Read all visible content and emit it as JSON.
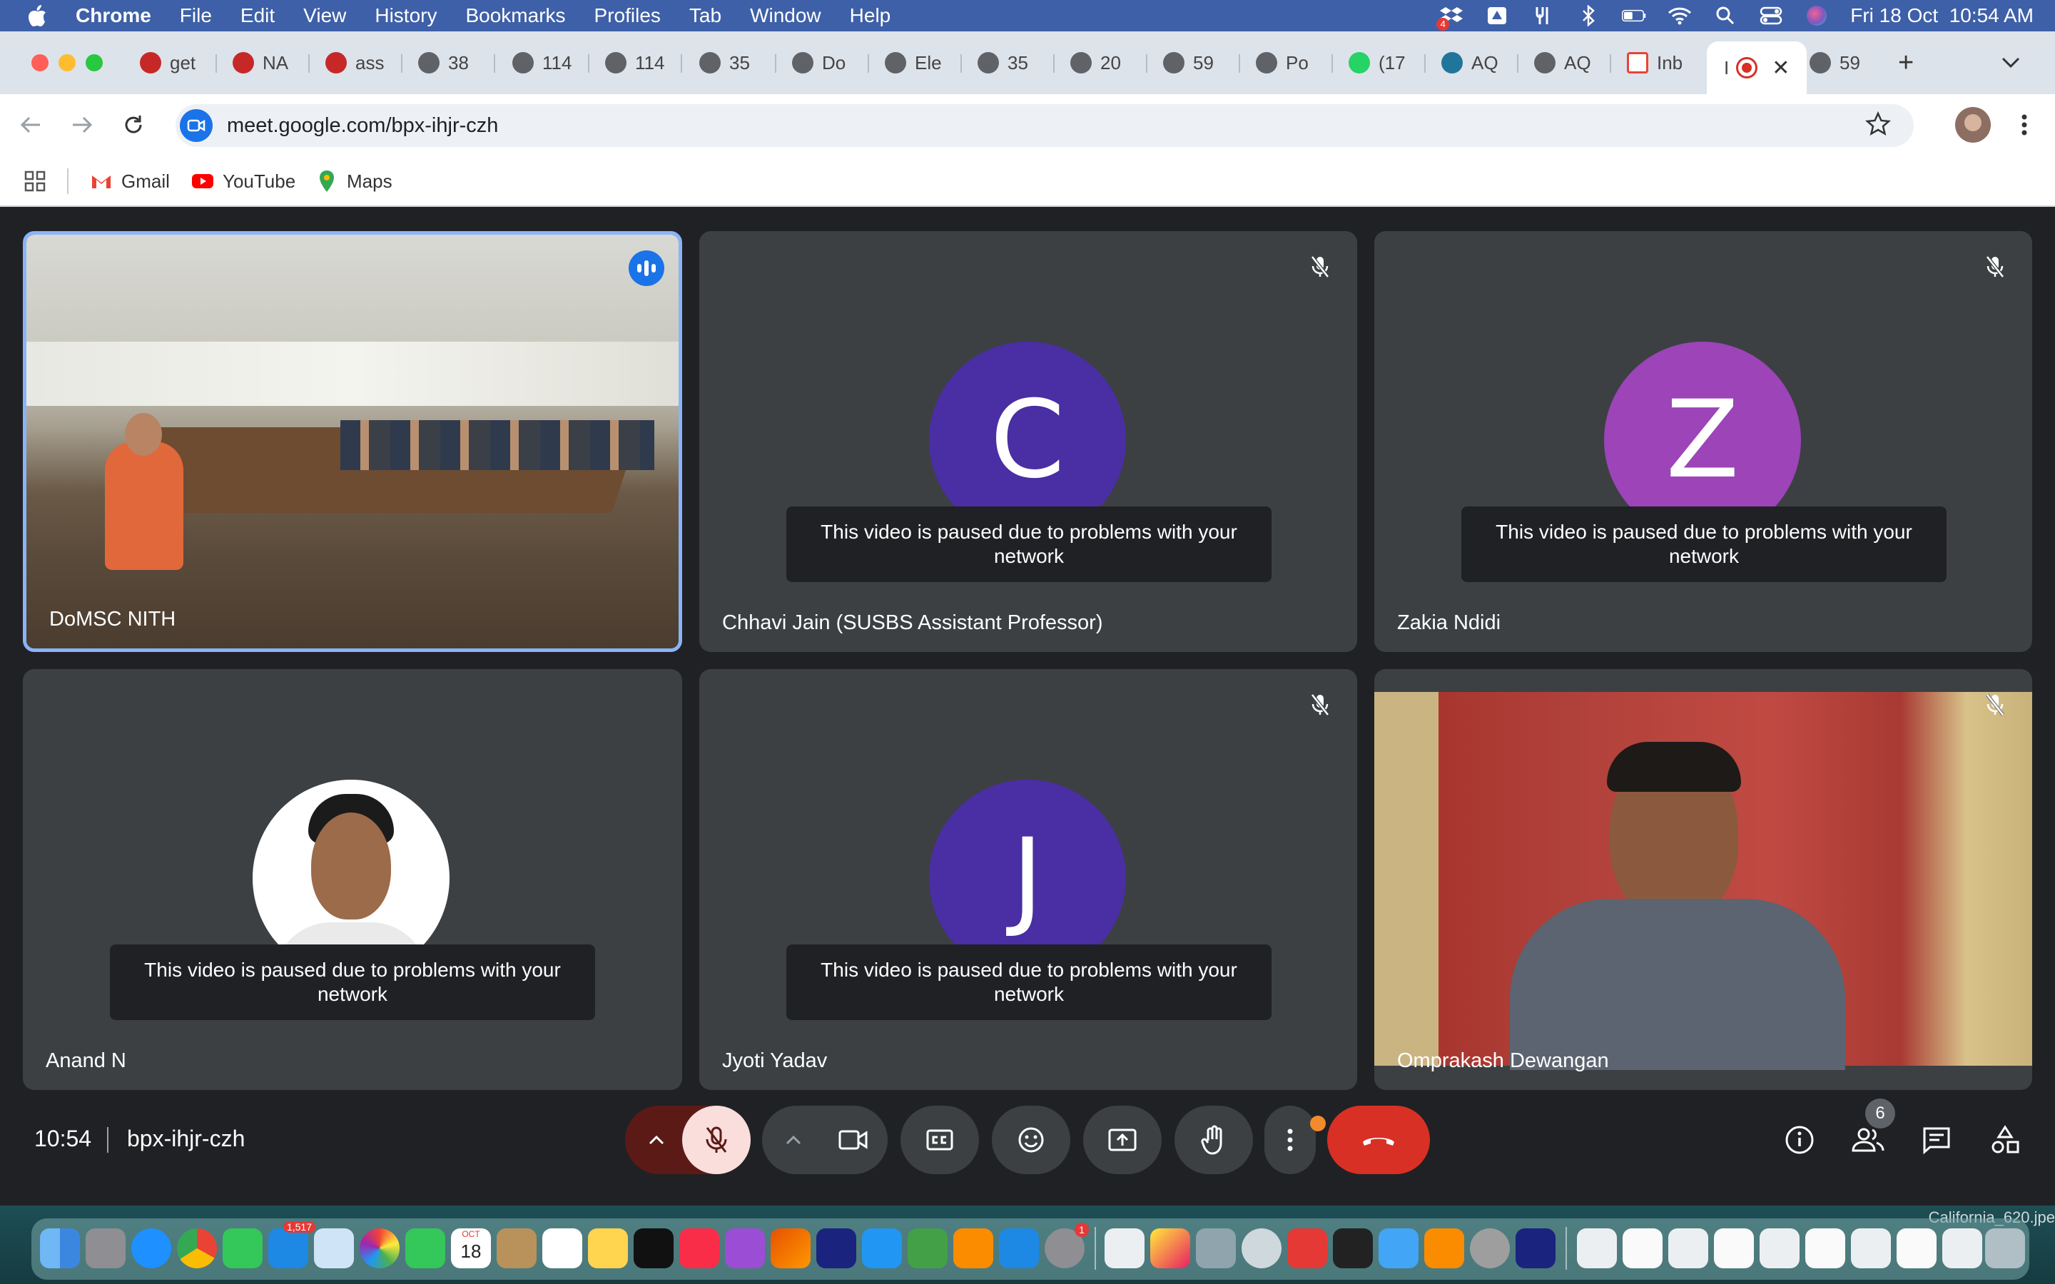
{
  "menubar": {
    "app": "Chrome",
    "items": [
      "File",
      "Edit",
      "View",
      "History",
      "Bookmarks",
      "Profiles",
      "Tab",
      "Window",
      "Help"
    ],
    "clock": "Fri 18 Oct  10:54 AM",
    "notification_badge": "4"
  },
  "tabs": [
    {
      "label": "get"
    },
    {
      "label": "NA"
    },
    {
      "label": "ass"
    },
    {
      "label": "38"
    },
    {
      "label": "114"
    },
    {
      "label": "114"
    },
    {
      "label": "35"
    },
    {
      "label": "Do"
    },
    {
      "label": "Ele"
    },
    {
      "label": "35"
    },
    {
      "label": "20"
    },
    {
      "label": "59"
    },
    {
      "label": "Po"
    },
    {
      "label": "(17"
    },
    {
      "label": "AQ"
    },
    {
      "label": "AQ"
    },
    {
      "label": "Inb"
    },
    {
      "label": "I",
      "active": true
    },
    {
      "label": "59"
    }
  ],
  "toolbar": {
    "url": "meet.google.com/bpx-ihjr-czh"
  },
  "bookmarks": [
    {
      "label": "Gmail"
    },
    {
      "label": "YouTube"
    },
    {
      "label": "Maps"
    }
  ],
  "meet": {
    "paused_message": "This video is paused due to problems with your network",
    "participants": [
      {
        "name": "DoMSC NITH",
        "speaking": true
      },
      {
        "name": "Chhavi Jain (SUSBS Assistant Professor)",
        "initial": "C",
        "color": "#4a2ea3"
      },
      {
        "name": "Zakia Ndidi",
        "initial": "Z",
        "color": "#9c44b8"
      },
      {
        "name": "Anand N"
      },
      {
        "name": "Jyoti Yadav",
        "initial": "J",
        "color": "#4a2ea3"
      },
      {
        "name": "Omprakash Dewangan"
      }
    ],
    "time": "10:54",
    "code": "bpx-ihjr-czh",
    "people_count": "6"
  },
  "dock": {
    "mail_badge": "1,517",
    "calendar_month": "OCT",
    "calendar_day": "18",
    "settings_badge": "1"
  },
  "wallpaper_label": "California_620.jpe"
}
